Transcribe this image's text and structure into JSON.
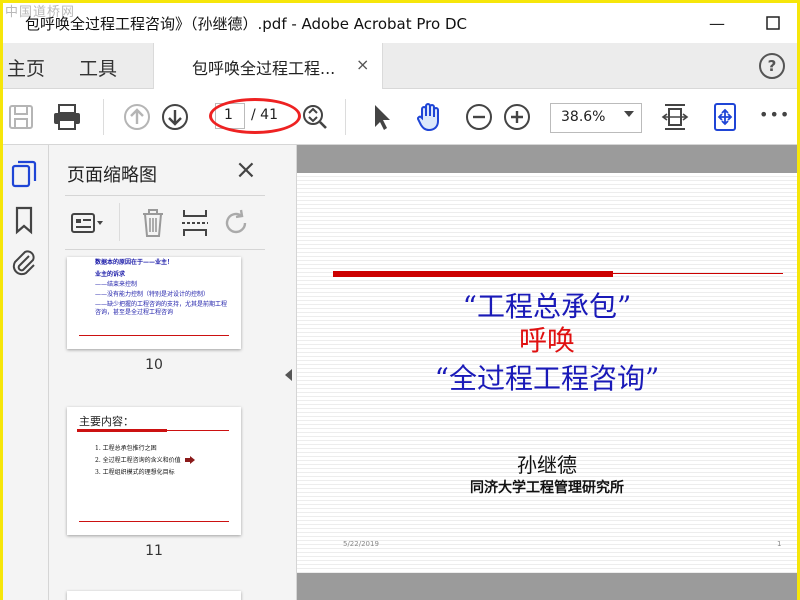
{
  "window": {
    "watermark": "中国道桥网",
    "title": "包呼唤全过程工程咨询》（孙继德）.pdf - Adobe Acrobat Pro DC",
    "minimize_label": "—",
    "maximize_label": "☐"
  },
  "tabs": {
    "home": "主页",
    "tools": "工具",
    "doc_tab_label": "包呼唤全过程工程...",
    "close_label": "×",
    "help_label": "?"
  },
  "toolbar": {
    "current_page": "1",
    "total_pages": "/ 41",
    "zoom": "38.6%",
    "more_label": "•••"
  },
  "panel": {
    "title": "页面缩略图",
    "close_label": "×",
    "thumbnails": [
      {
        "page_number": "10",
        "lines": [
          "数据本的原因在于——业主！",
          "业主的诉求",
          "——结束来控制",
          "——没有能力控制（特别是对设计的控制）",
          "——缺少把握的工程咨询的支持，尤其是前期工程",
          "咨询，甚至是全过程工程咨询"
        ]
      },
      {
        "page_number": "11",
        "heading": "主要内容：",
        "lines": [
          "1. 工程总承包推行之困",
          "2. 全过程工程咨询的含义和价值",
          "3. 工程组织模式的理想化目标"
        ]
      }
    ]
  },
  "slide": {
    "line1": "“工程总承包”",
    "line2": "呼唤",
    "line3": "“全过程工程咨询”",
    "author": "孙继德",
    "affiliation": "同济大学工程管理研究所",
    "date": "5/22/2019",
    "page_num": "1"
  },
  "colors": {
    "accent_blue": "#1f45d6",
    "slide_blue": "#1a1ab8",
    "slide_red": "#e01010",
    "highlight_red": "#e22222"
  }
}
